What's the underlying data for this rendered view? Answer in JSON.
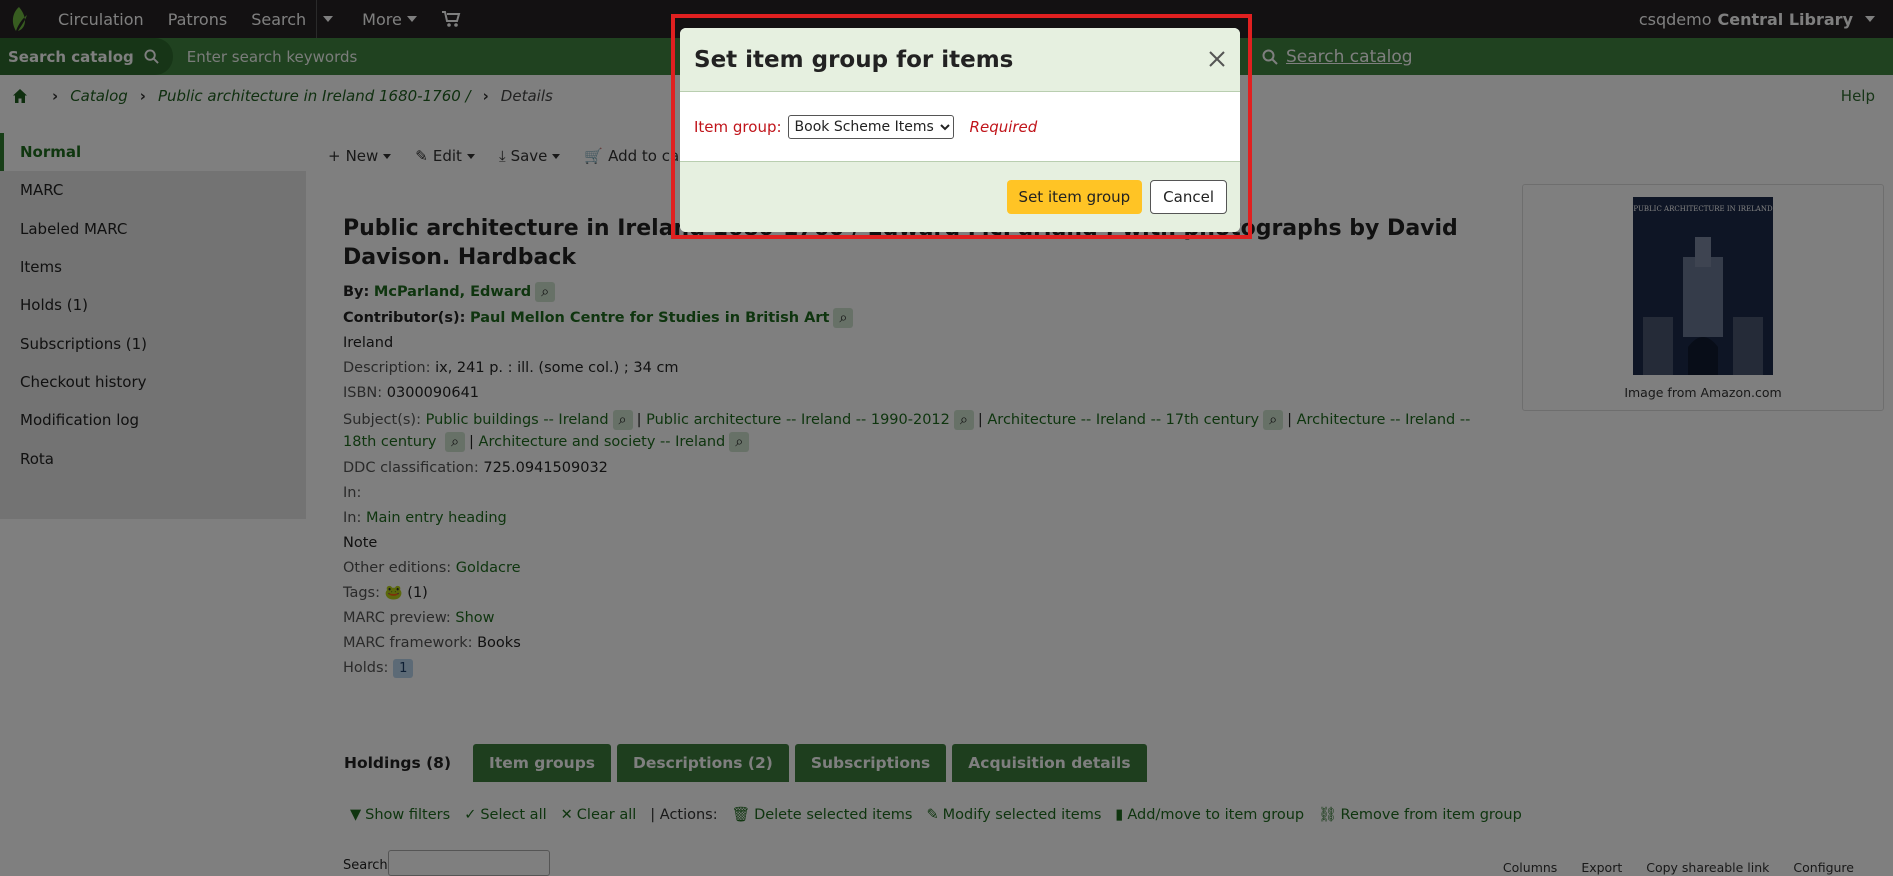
{
  "topnav": {
    "items": [
      "Circulation",
      "Patrons",
      "Search",
      "More"
    ],
    "user": "csqdemo",
    "library": "Central Library"
  },
  "searchbar": {
    "tab_label": "Search catalog",
    "placeholder": "Enter search keywords",
    "right_label": "Search catalog"
  },
  "breadcrumb": {
    "catalog": "Catalog",
    "record": "Public architecture in Ireland 1680-1760 /",
    "current": "Details",
    "help": "Help"
  },
  "leftmenu": {
    "items": [
      "Normal",
      "MARC",
      "Labeled MARC",
      "Items",
      "Holds (1)",
      "Subscriptions (1)",
      "Checkout history",
      "Modification log",
      "Rota"
    ]
  },
  "toolbar": {
    "new": "New",
    "edit": "Edit",
    "save": "Save",
    "add_to_cart": "Add to cart"
  },
  "record": {
    "title": "Public architecture in Ireland 1680-1760 / Edward McParland ; with photographs by David Davison. Hardback",
    "by_label": "By:",
    "author": "McParland, Edward",
    "contrib_label": "Contributor(s):",
    "contributor": "Paul Mellon Centre for Studies in British Art",
    "place": "Ireland",
    "desc_label": "Description:",
    "description": "ix, 241 p. : ill. (some col.) ; 34 cm",
    "isbn_label": "ISBN:",
    "isbn": "0300090641",
    "subjects_label": "Subject(s):",
    "subjects": [
      "Public buildings -- Ireland",
      "Public architecture -- Ireland -- 1990-2012",
      "Architecture -- Ireland -- 17th century",
      "Architecture -- Ireland -- 18th century",
      "Architecture and society -- Ireland"
    ],
    "ddc_label": "DDC classification:",
    "ddc": "725.0941509032",
    "in_label": "In:",
    "in2_label": "In:",
    "in2": "Main entry heading",
    "note": "Note",
    "other_label": "Other editions:",
    "other": "Goldacre",
    "tags_label": "Tags:",
    "tags_count": "(1)",
    "marc_preview_label": "MARC preview:",
    "marc_preview": "Show",
    "framework_label": "MARC framework:",
    "framework": "Books",
    "holds_label": "Holds:",
    "holds": "1"
  },
  "cover": {
    "caption": "Image from Amazon.com",
    "book_title": "PUBLIC ARCHITECTURE IN IRELAND"
  },
  "tabs": [
    "Holdings (8)",
    "Item groups",
    "Descriptions (2)",
    "Subscriptions",
    "Acquisition details"
  ],
  "holdings": {
    "show_filters": "Show filters",
    "select_all": "Select all",
    "clear_all": "Clear all",
    "actions_label": "| Actions:",
    "delete": "Delete selected items",
    "modify": "Modify selected items",
    "add_move": "Add/move to item group",
    "remove": "Remove from item group",
    "search_label": "Search:",
    "columns": "Columns",
    "export": "Export",
    "copy_link": "Copy shareable link",
    "configure": "Configure"
  },
  "modal": {
    "title": "Set item group for items",
    "field_label": "Item group:",
    "selected": "Book Scheme Items",
    "required": "Required",
    "submit": "Set item group",
    "cancel": "Cancel"
  },
  "colors": {
    "nav_bg": "#262324",
    "search_green": "#408540",
    "link_green": "#1e6b1e",
    "modal_tint": "#e6f0e0",
    "primary_yellow": "#ffc425",
    "highlight_red": "#e02020"
  }
}
